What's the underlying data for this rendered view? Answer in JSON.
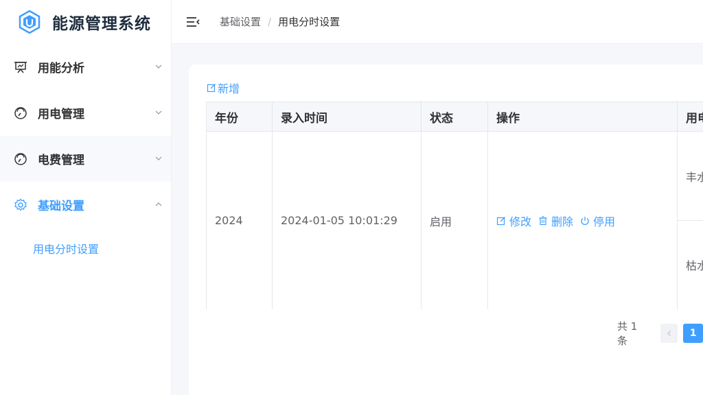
{
  "app": {
    "title": "能源管理系统"
  },
  "sidebar": {
    "items": [
      {
        "label": "用能分析",
        "icon": "presentation-icon",
        "expanded": false
      },
      {
        "label": "用电管理",
        "icon": "gauge-icon",
        "expanded": false
      },
      {
        "label": "电费管理",
        "icon": "gauge-icon",
        "expanded": false
      },
      {
        "label": "基础设置",
        "icon": "gear-icon",
        "expanded": true,
        "active": true
      }
    ],
    "submenu": [
      {
        "label": "用电分时设置",
        "active": true
      }
    ]
  },
  "header": {
    "breadcrumb": [
      "基础设置",
      "用电分时设置"
    ],
    "separator": "/"
  },
  "toolbar": {
    "add_label": "新增"
  },
  "table": {
    "columns": [
      "年份",
      "录入时间",
      "状态",
      "操作",
      "用电"
    ],
    "rows": [
      {
        "year": "2024",
        "entry_time": "2024-01-05 10:01:29",
        "status": "启用",
        "actions": [
          "修改",
          "删除",
          "停用"
        ],
        "sub": [
          "丰水",
          "枯水"
        ]
      }
    ]
  },
  "pagination": {
    "total_text": "共 1 条",
    "current_page": "1"
  },
  "colors": {
    "accent": "#409eff",
    "text": "#303133",
    "muted": "#606266",
    "border": "#e4e7ed"
  }
}
